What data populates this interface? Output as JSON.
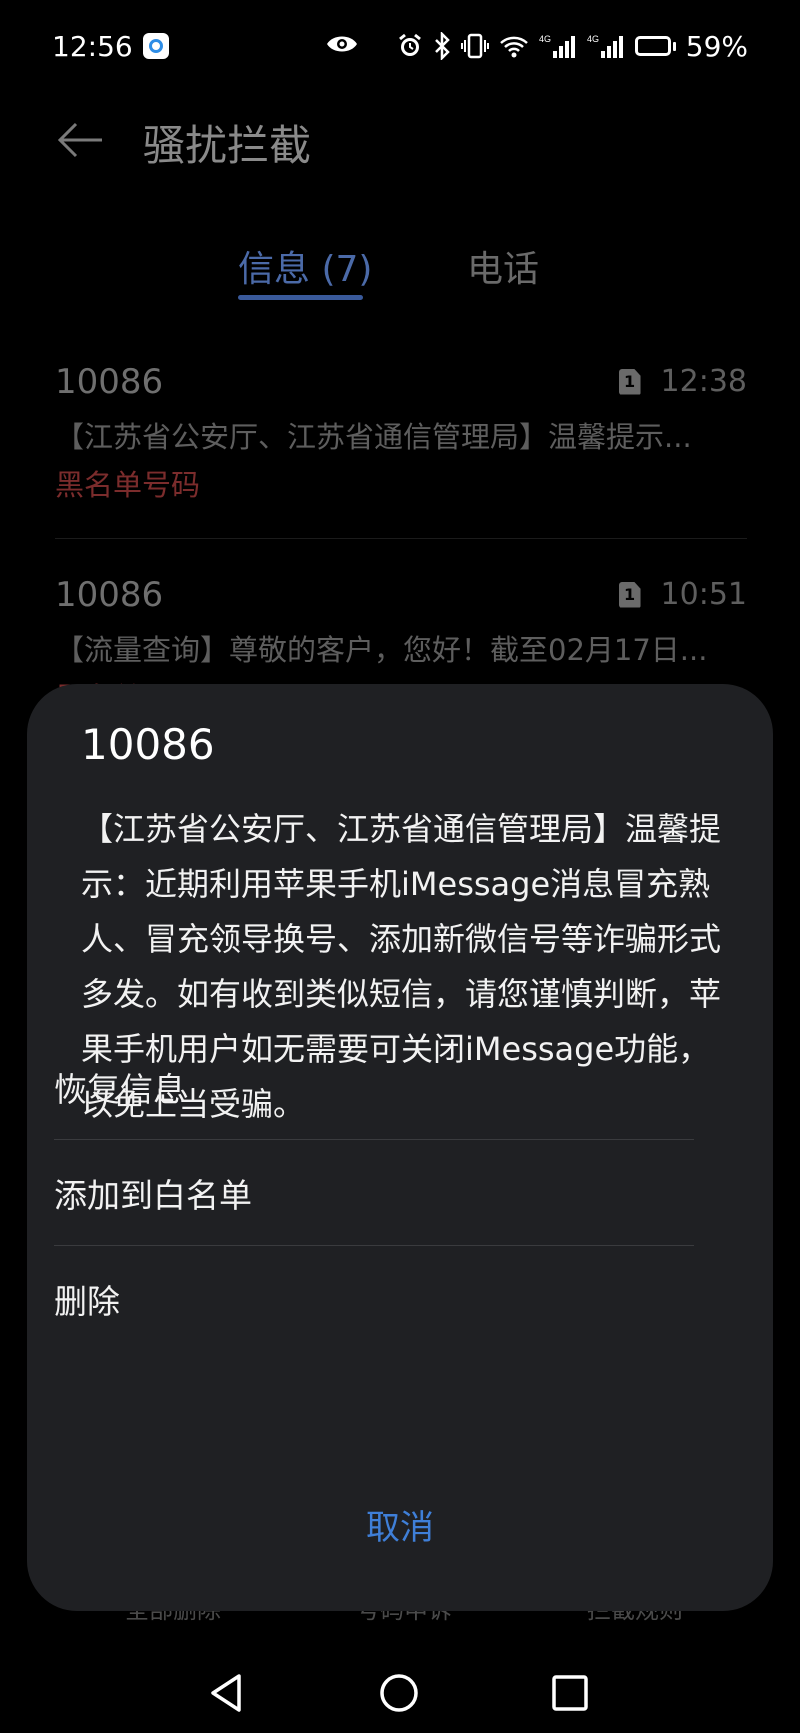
{
  "status_bar": {
    "time": "12:56",
    "battery_percent": "59%",
    "battery_level": 0.59,
    "network_1": "4G",
    "network_2": "4G"
  },
  "header": {
    "title": "骚扰拦截"
  },
  "tabs": [
    {
      "label": "信息 (7)",
      "active": true
    },
    {
      "label": "电话",
      "active": false
    }
  ],
  "messages": [
    {
      "sender": "10086",
      "time": "12:38",
      "sim": "1",
      "preview": "【江苏省公安厅、江苏省通信管理局】温馨提示...",
      "tag": "黑名单号码"
    },
    {
      "sender": "10086",
      "time": "10:51",
      "sim": "1",
      "preview": "【流量查询】尊敬的客户，您好！截至02月17日...",
      "tag": "黑名单号码"
    }
  ],
  "bottom_actions": {
    "delete_all": "全部删除",
    "appeal": "号码申诉",
    "rules": "拦截规则"
  },
  "sheet": {
    "title": "10086",
    "body": "【江苏省公安厅、江苏省通信管理局】温馨提示：近期利用苹果手机iMessage消息冒充熟人、冒充领导换号、添加新微信号等诈骗形式多发。如有收到类似短信，请您谨慎判断，苹果手机用户如无需要可关闭iMessage功能，以免上当受骗。",
    "options": {
      "restore": "恢复信息",
      "whitelist": "添加到白名单",
      "delete": "删除"
    },
    "cancel": "取消"
  },
  "colors": {
    "accent": "#3f7fd8",
    "tag_red": "#7b2c2c",
    "sheet_bg": "#1f2023"
  }
}
